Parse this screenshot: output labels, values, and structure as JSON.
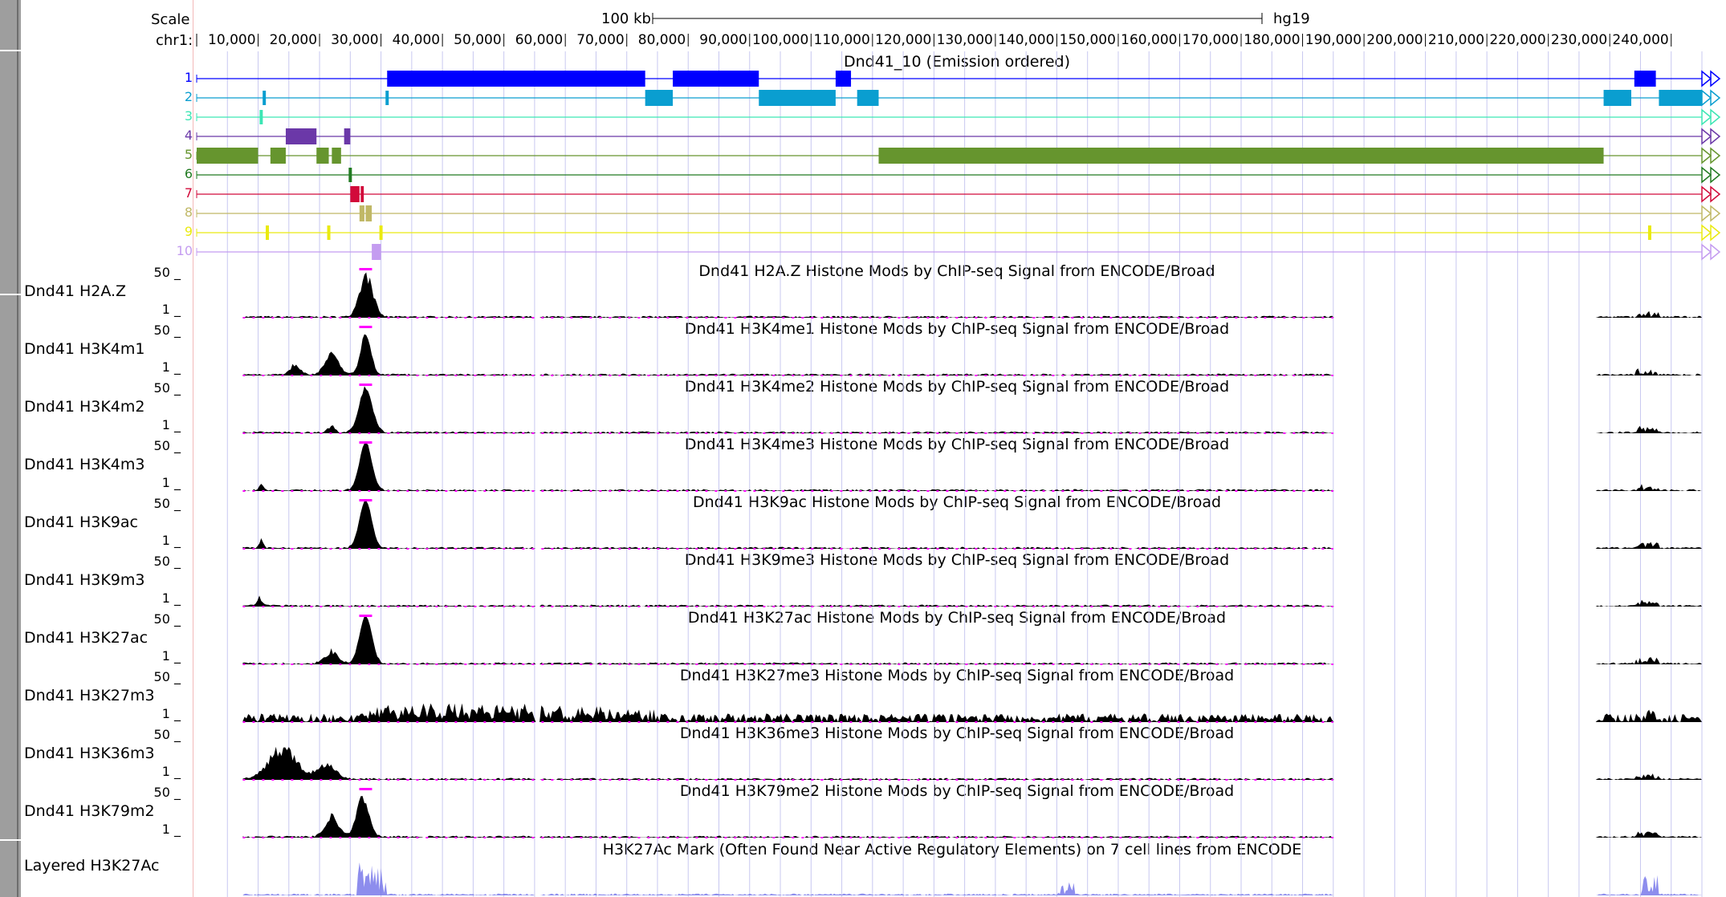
{
  "scale": {
    "label": "Scale",
    "bar_label": "100 kb",
    "assembly": "hg19",
    "chrom": "chr1:"
  },
  "ruler": {
    "start": 0,
    "end": 245000,
    "ticks": [
      "10,000",
      "20,000",
      "30,000",
      "40,000",
      "50,000",
      "60,000",
      "70,000",
      "80,000",
      "90,000",
      "100,000",
      "110,000",
      "120,000",
      "130,000",
      "140,000",
      "150,000",
      "160,000",
      "170,000",
      "180,000",
      "190,000",
      "200,000",
      "210,000",
      "220,000",
      "230,000",
      "240,000"
    ]
  },
  "chromhmm": {
    "title": "Dnd41_10 (Emission ordered)",
    "states": [
      {
        "num": "1",
        "color": "#0000ff",
        "blocks": [
          [
            31000,
            73000
          ],
          [
            77500,
            91500
          ],
          [
            104000,
            106500
          ],
          [
            234000,
            237500
          ]
        ],
        "ticks": []
      },
      {
        "num": "2",
        "color": "#0a9ed0",
        "blocks": [
          [
            73000,
            77500
          ],
          [
            91500,
            104000
          ],
          [
            107500,
            111000
          ],
          [
            229000,
            233500
          ],
          [
            238000,
            245000
          ]
        ],
        "ticks": [
          11000,
          31000
        ]
      },
      {
        "num": "3",
        "color": "#3ce6b4",
        "blocks": [],
        "ticks": [
          10500
        ]
      },
      {
        "num": "4",
        "color": "#6b38a8",
        "blocks": [
          [
            14500,
            19500
          ],
          [
            24000,
            25000
          ]
        ],
        "ticks": []
      },
      {
        "num": "5",
        "color": "#66952e",
        "blocks": [
          [
            0,
            10000
          ],
          [
            12000,
            14500
          ],
          [
            19500,
            21500
          ],
          [
            22000,
            23500
          ],
          [
            111000,
            229000
          ]
        ],
        "ticks": []
      },
      {
        "num": "6",
        "color": "#227b22",
        "blocks": [],
        "ticks": [
          25000
        ]
      },
      {
        "num": "7",
        "color": "#d20a3a",
        "blocks": [
          [
            25000,
            26500
          ],
          [
            26700,
            27200
          ]
        ],
        "ticks": []
      },
      {
        "num": "8",
        "color": "#c0b866",
        "blocks": [
          [
            26500,
            27300
          ],
          [
            27500,
            28500
          ]
        ],
        "ticks": []
      },
      {
        "num": "9",
        "color": "#eaea10",
        "blocks": [],
        "ticks": [
          11500,
          21500,
          30000,
          236500
        ]
      },
      {
        "num": "10",
        "color": "#c49cf0",
        "blocks": [
          [
            28500,
            30000
          ]
        ],
        "ticks": []
      }
    ]
  },
  "tracks": [
    {
      "label": "Dnd41 H2A.Z",
      "title": "Dnd41 H2A.Z Histone Mods by ChIP-seq Signal from ENCODE/Broad",
      "max": "50 _",
      "min": "1 _",
      "profile": "h2az"
    },
    {
      "label": "Dnd41 H3K4m1",
      "title": "Dnd41 H3K4me1 Histone Mods by ChIP-seq Signal from ENCODE/Broad",
      "max": "50 _",
      "min": "1 _",
      "profile": "k4m1"
    },
    {
      "label": "Dnd41 H3K4m2",
      "title": "Dnd41 H3K4me2 Histone Mods by ChIP-seq Signal from ENCODE/Broad",
      "max": "50 _",
      "min": "1 _",
      "profile": "k4m2"
    },
    {
      "label": "Dnd41 H3K4m3",
      "title": "Dnd41 H3K4me3 Histone Mods by ChIP-seq Signal from ENCODE/Broad",
      "max": "50 _",
      "min": "1 _",
      "profile": "k4m3"
    },
    {
      "label": "Dnd41 H3K9ac",
      "title": "Dnd41 H3K9ac Histone Mods by ChIP-seq Signal from ENCODE/Broad",
      "max": "50 _",
      "min": "1 _",
      "profile": "k9ac"
    },
    {
      "label": "Dnd41 H3K9m3",
      "title": "Dnd41 H3K9me3 Histone Mods by ChIP-seq Signal from ENCODE/Broad",
      "max": "50 _",
      "min": "1 _",
      "profile": "k9m3"
    },
    {
      "label": "Dnd41 H3K27ac",
      "title": "Dnd41 H3K27ac Histone Mods by ChIP-seq Signal from ENCODE/Broad",
      "max": "50 _",
      "min": "1 _",
      "profile": "k27ac"
    },
    {
      "label": "Dnd41 H3K27m3",
      "title": "Dnd41 H3K27me3 Histone Mods by ChIP-seq Signal from ENCODE/Broad",
      "max": "50 _",
      "min": "1 _",
      "profile": "k27m3"
    },
    {
      "label": "Dnd41 H3K36m3",
      "title": "Dnd41 H3K36me3 Histone Mods by ChIP-seq Signal from ENCODE/Broad",
      "max": "50 _",
      "min": "1 _",
      "profile": "k36m3"
    },
    {
      "label": "Dnd41 H3K79m2",
      "title": "Dnd41 H3K79me2 Histone Mods by ChIP-seq Signal from ENCODE/Broad",
      "max": "50 _",
      "min": "1 _",
      "profile": "k79m2"
    }
  ],
  "layered": {
    "label": "Layered H3K27Ac",
    "title": "H3K27Ac Mark (Often Found Near Active Regulatory Elements) on 7 cell lines from ENCODE"
  },
  "colors": {
    "signal": "#000000",
    "clip": "#ff00ff",
    "gridline": "#c8c8f0",
    "layered": "#7070e8"
  }
}
